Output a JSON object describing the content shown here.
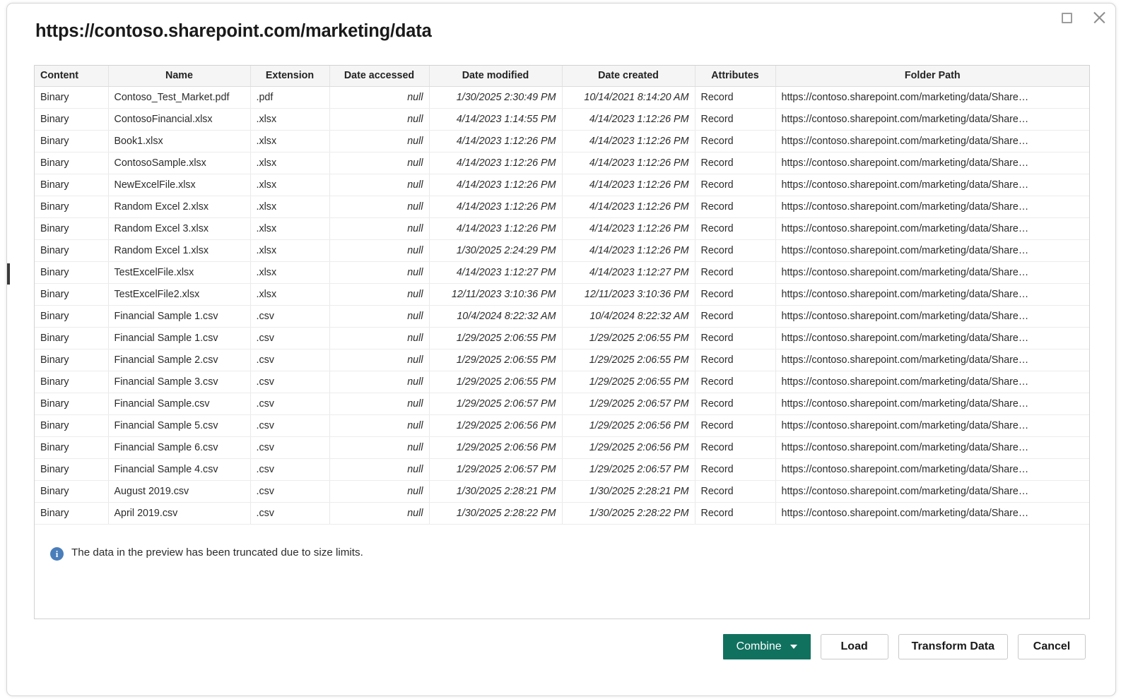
{
  "window": {
    "restore_label": "Restore",
    "close_label": "Close"
  },
  "dialog": {
    "title": "https://contoso.sharepoint.com/marketing/data"
  },
  "table": {
    "columns": [
      {
        "key": "content",
        "label": "Content"
      },
      {
        "key": "name",
        "label": "Name"
      },
      {
        "key": "ext",
        "label": "Extension"
      },
      {
        "key": "accessed",
        "label": "Date accessed"
      },
      {
        "key": "modified",
        "label": "Date modified"
      },
      {
        "key": "created",
        "label": "Date created"
      },
      {
        "key": "attrs",
        "label": "Attributes"
      },
      {
        "key": "path",
        "label": "Folder Path"
      }
    ],
    "rows": [
      {
        "content": "Binary",
        "name": "Contoso_Test_Market.pdf",
        "ext": ".pdf",
        "accessed": "null",
        "modified": "1/30/2025 2:30:49 PM",
        "created": "10/14/2021 8:14:20 AM",
        "attrs": "Record",
        "path": "https://contoso.sharepoint.com/marketing/data/Share…"
      },
      {
        "content": "Binary",
        "name": "ContosoFinancial.xlsx",
        "ext": ".xlsx",
        "accessed": "null",
        "modified": "4/14/2023 1:14:55 PM",
        "created": "4/14/2023 1:12:26 PM",
        "attrs": "Record",
        "path": "https://contoso.sharepoint.com/marketing/data/Share…"
      },
      {
        "content": "Binary",
        "name": "Book1.xlsx",
        "ext": ".xlsx",
        "accessed": "null",
        "modified": "4/14/2023 1:12:26 PM",
        "created": "4/14/2023 1:12:26 PM",
        "attrs": "Record",
        "path": "https://contoso.sharepoint.com/marketing/data/Share…"
      },
      {
        "content": "Binary",
        "name": "ContosoSample.xlsx",
        "ext": ".xlsx",
        "accessed": "null",
        "modified": "4/14/2023 1:12:26 PM",
        "created": "4/14/2023 1:12:26 PM",
        "attrs": "Record",
        "path": "https://contoso.sharepoint.com/marketing/data/Share…"
      },
      {
        "content": "Binary",
        "name": "NewExcelFile.xlsx",
        "ext": ".xlsx",
        "accessed": "null",
        "modified": "4/14/2023 1:12:26 PM",
        "created": "4/14/2023 1:12:26 PM",
        "attrs": "Record",
        "path": "https://contoso.sharepoint.com/marketing/data/Share…"
      },
      {
        "content": "Binary",
        "name": "Random Excel 2.xlsx",
        "ext": ".xlsx",
        "accessed": "null",
        "modified": "4/14/2023 1:12:26 PM",
        "created": "4/14/2023 1:12:26 PM",
        "attrs": "Record",
        "path": "https://contoso.sharepoint.com/marketing/data/Share…"
      },
      {
        "content": "Binary",
        "name": "Random Excel 3.xlsx",
        "ext": ".xlsx",
        "accessed": "null",
        "modified": "4/14/2023 1:12:26 PM",
        "created": "4/14/2023 1:12:26 PM",
        "attrs": "Record",
        "path": "https://contoso.sharepoint.com/marketing/data/Share…"
      },
      {
        "content": "Binary",
        "name": "Random Excel 1.xlsx",
        "ext": ".xlsx",
        "accessed": "null",
        "modified": "1/30/2025 2:24:29 PM",
        "created": "4/14/2023 1:12:26 PM",
        "attrs": "Record",
        "path": "https://contoso.sharepoint.com/marketing/data/Share…"
      },
      {
        "content": "Binary",
        "name": "TestExcelFile.xlsx",
        "ext": ".xlsx",
        "accessed": "null",
        "modified": "4/14/2023 1:12:27 PM",
        "created": "4/14/2023 1:12:27 PM",
        "attrs": "Record",
        "path": "https://contoso.sharepoint.com/marketing/data/Share…"
      },
      {
        "content": "Binary",
        "name": "TestExcelFile2.xlsx",
        "ext": ".xlsx",
        "accessed": "null",
        "modified": "12/11/2023 3:10:36 PM",
        "created": "12/11/2023 3:10:36 PM",
        "attrs": "Record",
        "path": "https://contoso.sharepoint.com/marketing/data/Share…"
      },
      {
        "content": "Binary",
        "name": "Financial Sample 1.csv",
        "ext": ".csv",
        "accessed": "null",
        "modified": "10/4/2024 8:22:32 AM",
        "created": "10/4/2024 8:22:32 AM",
        "attrs": "Record",
        "path": "https://contoso.sharepoint.com/marketing/data/Share…"
      },
      {
        "content": "Binary",
        "name": "Financial Sample 1.csv",
        "ext": ".csv",
        "accessed": "null",
        "modified": "1/29/2025 2:06:55 PM",
        "created": "1/29/2025 2:06:55 PM",
        "attrs": "Record",
        "path": "https://contoso.sharepoint.com/marketing/data/Share…"
      },
      {
        "content": "Binary",
        "name": "Financial Sample 2.csv",
        "ext": ".csv",
        "accessed": "null",
        "modified": "1/29/2025 2:06:55 PM",
        "created": "1/29/2025 2:06:55 PM",
        "attrs": "Record",
        "path": "https://contoso.sharepoint.com/marketing/data/Share…"
      },
      {
        "content": "Binary",
        "name": "Financial Sample 3.csv",
        "ext": ".csv",
        "accessed": "null",
        "modified": "1/29/2025 2:06:55 PM",
        "created": "1/29/2025 2:06:55 PM",
        "attrs": "Record",
        "path": "https://contoso.sharepoint.com/marketing/data/Share…"
      },
      {
        "content": "Binary",
        "name": "Financial Sample.csv",
        "ext": ".csv",
        "accessed": "null",
        "modified": "1/29/2025 2:06:57 PM",
        "created": "1/29/2025 2:06:57 PM",
        "attrs": "Record",
        "path": "https://contoso.sharepoint.com/marketing/data/Share…"
      },
      {
        "content": "Binary",
        "name": "Financial Sample 5.csv",
        "ext": ".csv",
        "accessed": "null",
        "modified": "1/29/2025 2:06:56 PM",
        "created": "1/29/2025 2:06:56 PM",
        "attrs": "Record",
        "path": "https://contoso.sharepoint.com/marketing/data/Share…"
      },
      {
        "content": "Binary",
        "name": "Financial Sample 6.csv",
        "ext": ".csv",
        "accessed": "null",
        "modified": "1/29/2025 2:06:56 PM",
        "created": "1/29/2025 2:06:56 PM",
        "attrs": "Record",
        "path": "https://contoso.sharepoint.com/marketing/data/Share…"
      },
      {
        "content": "Binary",
        "name": "Financial Sample 4.csv",
        "ext": ".csv",
        "accessed": "null",
        "modified": "1/29/2025 2:06:57 PM",
        "created": "1/29/2025 2:06:57 PM",
        "attrs": "Record",
        "path": "https://contoso.sharepoint.com/marketing/data/Share…"
      },
      {
        "content": "Binary",
        "name": "August 2019.csv",
        "ext": ".csv",
        "accessed": "null",
        "modified": "1/30/2025 2:28:21 PM",
        "created": "1/30/2025 2:28:21 PM",
        "attrs": "Record",
        "path": "https://contoso.sharepoint.com/marketing/data/Share…"
      },
      {
        "content": "Binary",
        "name": "April 2019.csv",
        "ext": ".csv",
        "accessed": "null",
        "modified": "1/30/2025 2:28:22 PM",
        "created": "1/30/2025 2:28:22 PM",
        "attrs": "Record",
        "path": "https://contoso.sharepoint.com/marketing/data/Share…"
      }
    ]
  },
  "info": {
    "icon": "info-icon",
    "glyph": "i",
    "message": "The data in the preview has been truncated due to size limits."
  },
  "footer": {
    "combine_label": "Combine",
    "load_label": "Load",
    "transform_label": "Transform Data",
    "cancel_label": "Cancel"
  },
  "colors": {
    "primary": "#10715f",
    "info": "#4a7ebb",
    "header_bg": "#f5f5f5",
    "border": "#d2d2d2",
    "text": "#2b2b2b"
  }
}
